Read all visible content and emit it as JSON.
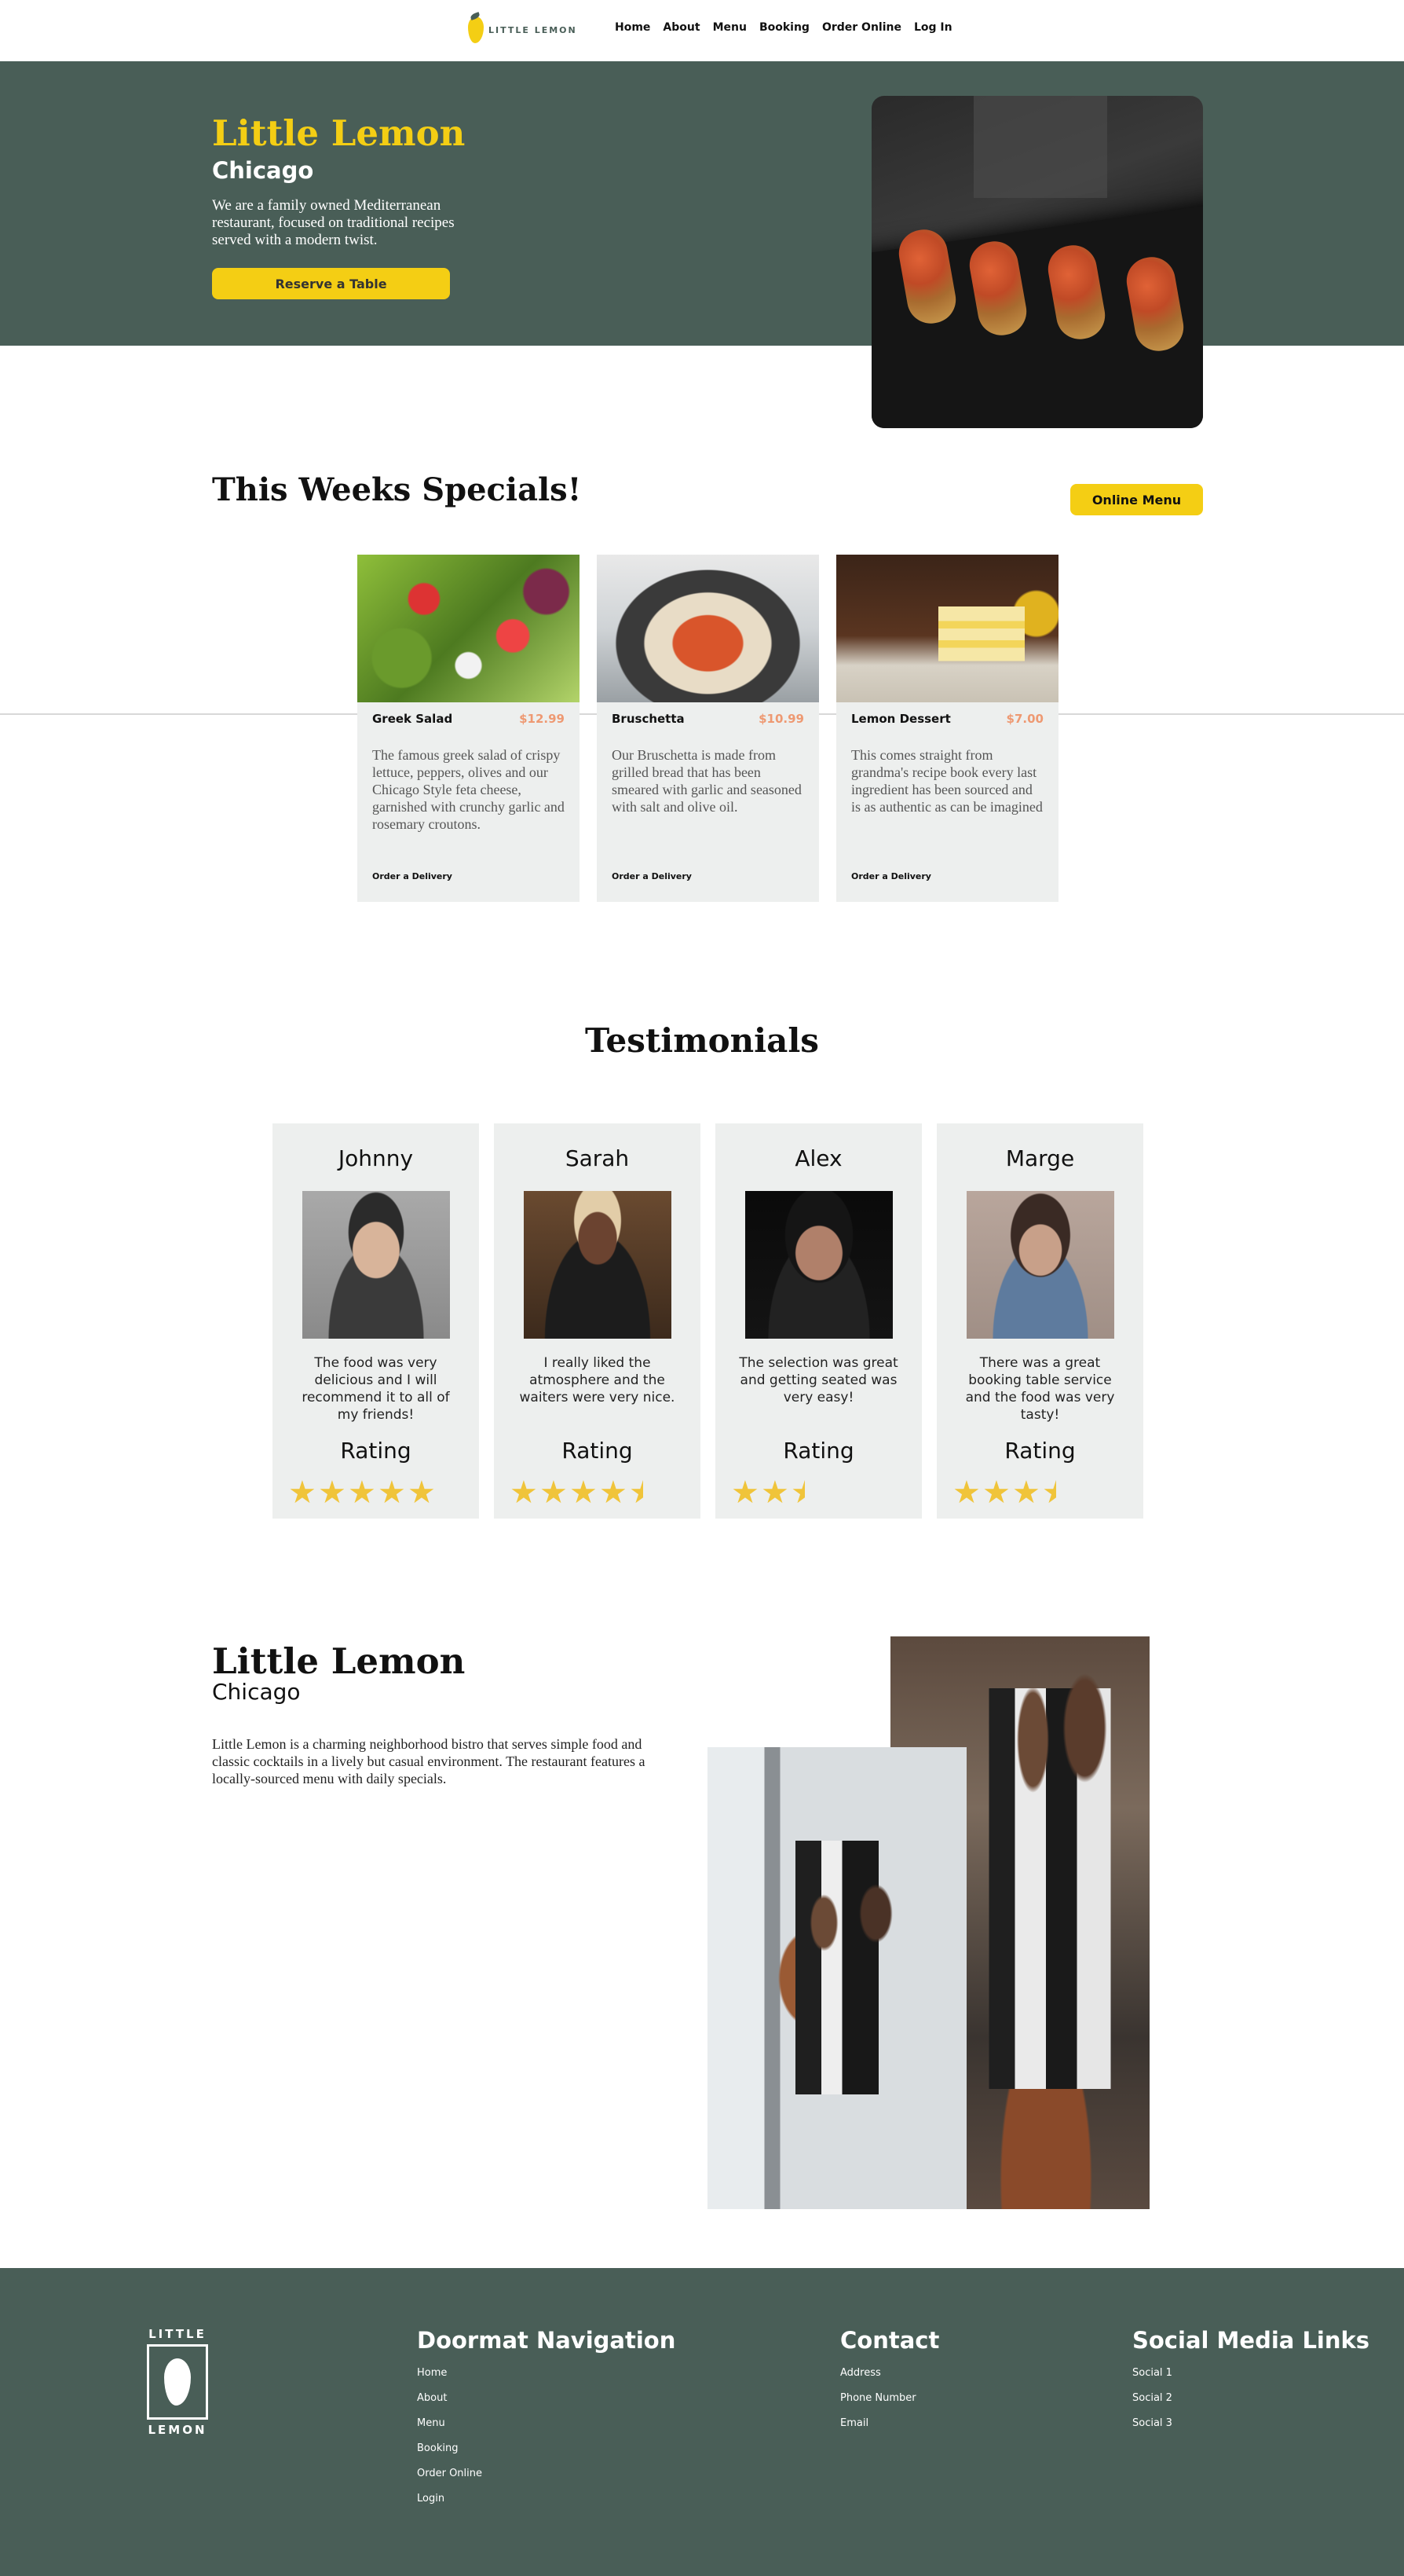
{
  "header": {
    "logo_text": "LITTLE LEMON",
    "nav": [
      "Home",
      "About",
      "Menu",
      "Booking",
      "Order Online",
      "Log In"
    ]
  },
  "hero": {
    "title": "Little Lemon",
    "subtitle": "Chicago",
    "text": "We are a family owned Mediterranean restaurant, focused on traditional recipes served with a modern twist.",
    "button": "Reserve a Table"
  },
  "specials": {
    "title": "This Weeks Specials!",
    "button": "Online Menu",
    "items": [
      {
        "name": "Greek Salad",
        "price": "$12.99",
        "description": "The famous greek salad of crispy lettuce, peppers, olives and our Chicago Style feta cheese, garnished with crunchy garlic and rosemary croutons.",
        "action": "Order a Delivery"
      },
      {
        "name": "Bruschetta",
        "price": "$10.99",
        "description": "Our Bruschetta is made from grilled bread that has been smeared with garlic and seasoned with salt and olive oil.",
        "action": "Order a Delivery"
      },
      {
        "name": "Lemon Dessert",
        "price": "$7.00",
        "description": "This comes straight from grandma's recipe book every last ingredient has been sourced and is as authentic as can be imagined",
        "action": "Order a Delivery"
      }
    ]
  },
  "testimonials": {
    "title": "Testimonials",
    "rating_label": "Rating",
    "items": [
      {
        "name": "Johnny",
        "quote": "The food was very delicious and I will recommend it to all of my friends!",
        "rating": 5
      },
      {
        "name": "Sarah",
        "quote": "I really liked the atmosphere and the waiters were very nice.",
        "rating": 4.5
      },
      {
        "name": "Alex",
        "quote": "The selection was great and getting seated was very easy!",
        "rating": 2.5
      },
      {
        "name": "Marge",
        "quote": "There was a great booking table service and the food was very tasty!",
        "rating": 3.5
      }
    ]
  },
  "about": {
    "title": "Little Lemon",
    "subtitle": "Chicago",
    "text": "Little Lemon is a charming neighborhood bistro that serves simple food and classic cocktails in a lively but casual environment. The restaurant features a locally-sourced menu with daily specials."
  },
  "footer": {
    "logo_top": "LITTLE",
    "logo_bottom": "LEMON",
    "nav_heading": "Doormat Navigation",
    "nav_links": [
      "Home",
      "About",
      "Menu",
      "Booking",
      "Order Online",
      "Login"
    ],
    "contact_heading": "Contact",
    "contact_links": [
      "Address",
      "Phone Number",
      "Email"
    ],
    "social_heading": "Social Media Links",
    "social_links": [
      "Social 1",
      "Social 2",
      "Social 3"
    ]
  },
  "colors": {
    "primary_green": "#495e57",
    "primary_yellow": "#f4ce14",
    "price_salmon": "#ee9972",
    "card_gray": "#edefee",
    "star": "#f0c43a"
  }
}
